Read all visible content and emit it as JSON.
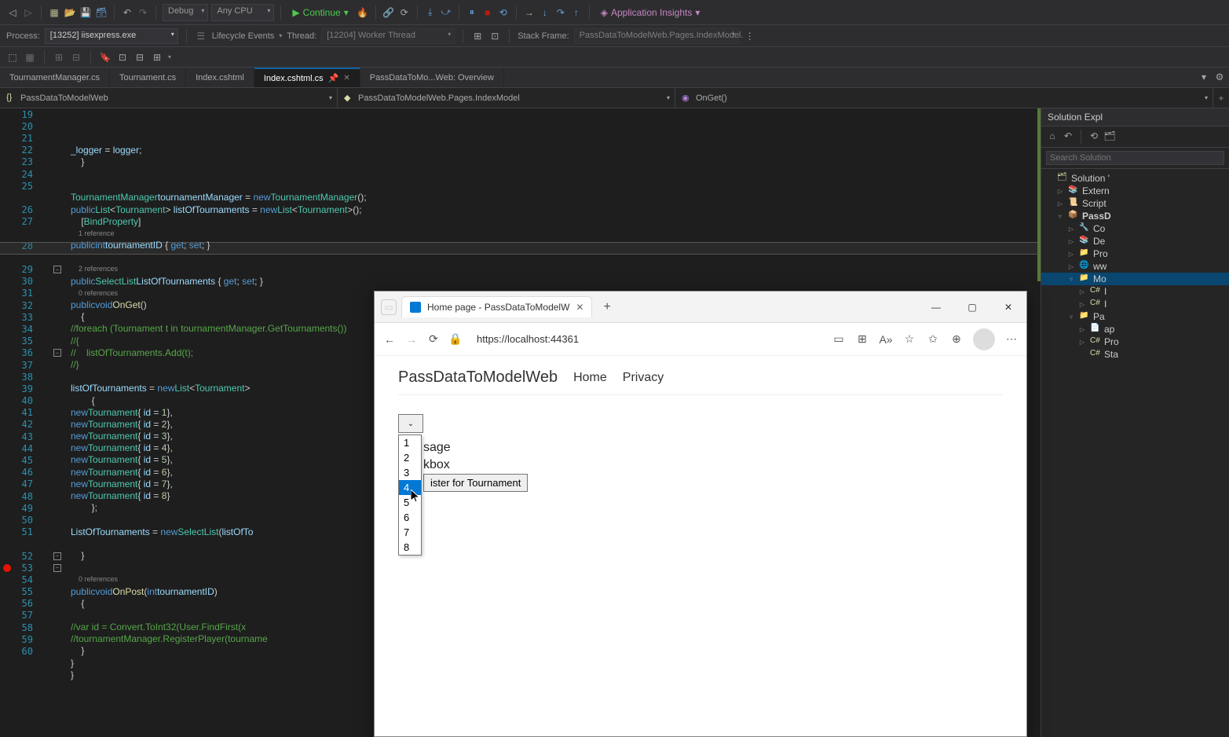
{
  "toolbar": {
    "configuration": "Debug",
    "platform": "Any CPU",
    "continue_label": "Continue",
    "app_insights": "Application Insights"
  },
  "debugBar": {
    "process_label": "Process:",
    "process_value": "[13252] iisexpress.exe",
    "lifecycle_label": "Lifecycle Events",
    "thread_label": "Thread:",
    "thread_value": "[12204] Worker Thread",
    "stackframe_label": "Stack Frame:",
    "stackframe_value": "PassDataToModelWeb.Pages.IndexModel."
  },
  "tabs": [
    {
      "label": "TournamentManager.cs",
      "active": false
    },
    {
      "label": "Tournament.cs",
      "active": false
    },
    {
      "label": "Index.cshtml",
      "active": false
    },
    {
      "label": "Index.cshtml.cs",
      "active": true,
      "pinned": true
    },
    {
      "label": "PassDataToMo...Web: Overview",
      "active": false
    }
  ],
  "breadcrumbs": {
    "namespace": "PassDataToModelWeb",
    "class": "PassDataToModelWeb.Pages.IndexModel",
    "method": "OnGet()"
  },
  "lineNumbers": [
    19,
    20,
    21,
    22,
    23,
    24,
    25,
    26,
    27,
    28,
    29,
    30,
    31,
    32,
    33,
    34,
    35,
    36,
    37,
    38,
    39,
    40,
    41,
    42,
    43,
    44,
    45,
    46,
    47,
    48,
    49,
    50,
    51,
    52,
    53,
    54,
    55,
    56,
    57,
    58,
    59,
    60
  ],
  "code": {
    "l19": "_logger = logger;",
    "l23_a": "TournamentManager",
    "l23_b": "tournamentManager",
    "l23_c": "new",
    "l23_d": "TournamentManager",
    "l24_a": "public",
    "l24_b": "List",
    "l24_c": "Tournament",
    "l24_d": "listOfTournaments",
    "l24_e": "new",
    "l24_f": "List",
    "l24_g": "Tournament",
    "l25_a": "BindProperty",
    "l25_ref": "1 reference",
    "l26_a": "public",
    "l26_b": "int",
    "l26_c": "tournamentID",
    "l26_d": "get",
    "l26_e": "set",
    "l27_ref": "2 references",
    "l28_a": "public",
    "l28_b": "SelectList",
    "l28_c": "ListOfTournaments",
    "l28_d": "get",
    "l28_e": "set",
    "l28_ref": "0 references",
    "l29_a": "public",
    "l29_b": "void",
    "l29_c": "OnGet",
    "l31": "//foreach (Tournament t in tournamentManager.GetTournaments())",
    "l32": "//{",
    "l33": "//    listOfTournaments.Add(t);",
    "l34": "//}",
    "l36_a": "listOfTournaments",
    "l36_b": "new",
    "l36_c": "List",
    "l36_d": "Tournament",
    "newtourn": "new",
    "tourntype": "Tournament",
    "idprop": "id",
    "ids": [
      "1",
      "2",
      "3",
      "4",
      "5",
      "6",
      "7",
      "8"
    ],
    "l48_a": "ListOfTournaments",
    "l48_b": "new",
    "l48_c": "SelectList",
    "l48_d": "listOfTo",
    "l51_ref": "0 references",
    "l52_a": "public",
    "l52_b": "void",
    "l52_c": "OnPost",
    "l52_d": "int",
    "l52_e": "tournamentID",
    "l55": "//var id = Convert.ToInt32(User.FindFirst(x",
    "l56": "//tournamentManager.RegisterPlayer(tourname"
  },
  "solutionExplorer": {
    "title": "Solution Expl",
    "search_placeholder": "Search Solution",
    "nodes": [
      {
        "indent": 0,
        "exp": "",
        "label": "Solution '",
        "icon": "sln"
      },
      {
        "indent": 1,
        "exp": "▷",
        "label": "Extern",
        "icon": "ref"
      },
      {
        "indent": 1,
        "exp": "▷",
        "label": "Script",
        "icon": "script"
      },
      {
        "indent": 1,
        "exp": "▿",
        "label": "PassD",
        "icon": "proj",
        "bold": true
      },
      {
        "indent": 2,
        "exp": "▷",
        "label": "Co",
        "icon": "wrench"
      },
      {
        "indent": 2,
        "exp": "▷",
        "label": "De",
        "icon": "ref"
      },
      {
        "indent": 2,
        "exp": "▷",
        "label": "Pro",
        "icon": "folder"
      },
      {
        "indent": 2,
        "exp": "▷",
        "label": "ww",
        "icon": "globe"
      },
      {
        "indent": 2,
        "exp": "▿",
        "label": "Mo",
        "icon": "folder",
        "sel": true
      },
      {
        "indent": 3,
        "exp": "▷",
        "label": "I",
        "icon": "cs"
      },
      {
        "indent": 3,
        "exp": "▷",
        "label": "I",
        "icon": "cs"
      },
      {
        "indent": 2,
        "exp": "▿",
        "label": "Pa",
        "icon": "folder"
      },
      {
        "indent": 3,
        "exp": "▷",
        "label": "ap",
        "icon": "file"
      },
      {
        "indent": 3,
        "exp": "▷",
        "label": "Pro",
        "icon": "cs"
      },
      {
        "indent": 3,
        "exp": "",
        "label": "Sta",
        "icon": "cs"
      }
    ]
  },
  "browser": {
    "tab_title": "Home page - PassDataToModelW",
    "url": "https://localhost:44361",
    "brand": "PassDataToModelWeb",
    "nav_home": "Home",
    "nav_privacy": "Privacy",
    "options": [
      "1",
      "2",
      "3",
      "4",
      "5",
      "6",
      "7",
      "8"
    ],
    "selected_index": 3,
    "partial_text1": "sage",
    "partial_text2": "kbox",
    "button_partial": "ister for Tournament"
  }
}
